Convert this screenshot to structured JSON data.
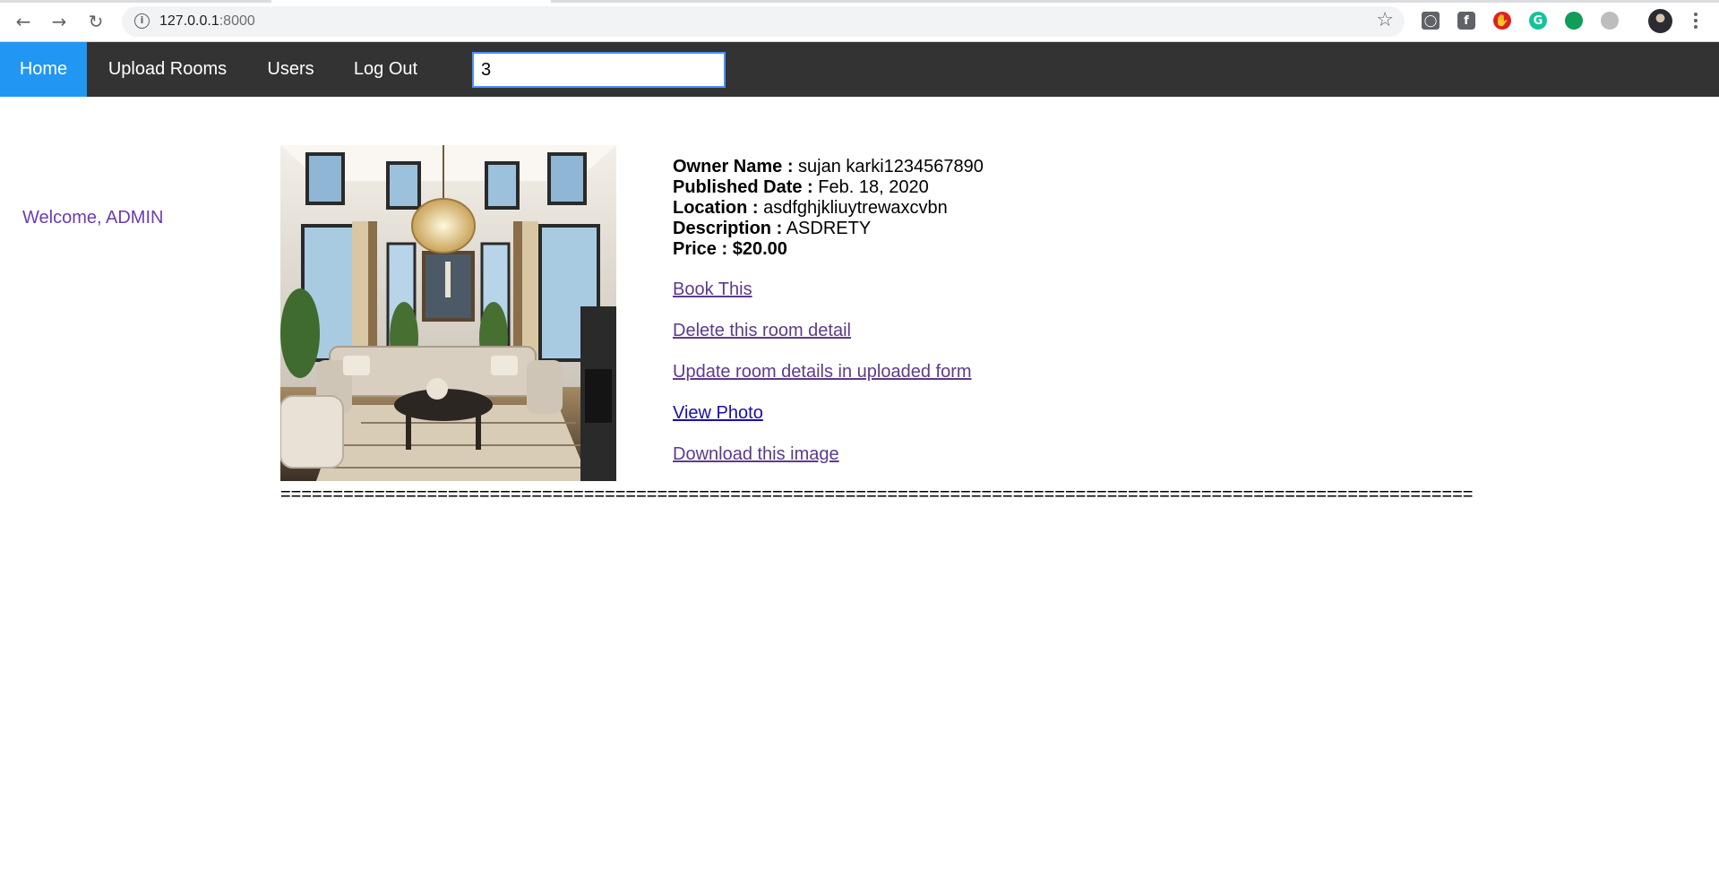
{
  "browser": {
    "url_host": "127.0.0.1",
    "url_port": ":8000"
  },
  "nav": {
    "items": [
      {
        "label": "Home",
        "active": true
      },
      {
        "label": "Upload Rooms",
        "active": false
      },
      {
        "label": "Users",
        "active": false
      },
      {
        "label": "Log Out",
        "active": false
      }
    ],
    "search_value": "3"
  },
  "colors": {
    "nav_bg": "#333333",
    "nav_active": "#2196F3",
    "link_visited": "#5c3a8c",
    "link_blue": "#1a0dab"
  },
  "welcome": "Welcome, ADMIN",
  "room": {
    "owner_label": "Owner Name :",
    "owner_value": "sujan karki1234567890",
    "date_label": "Published Date :",
    "date_value": "Feb. 18, 2020",
    "location_label": "Location :",
    "location_value": "asdfghjkliuytrewaxcvbn",
    "description_label": "Description :",
    "description_value": "ASDRETY",
    "price_label": "Price :",
    "price_value": "$20.00",
    "links": {
      "book": "Book This",
      "delete": "Delete this room detail",
      "update": "Update room details in uploaded form",
      "view_photo": "View Photo",
      "download": "Download this image"
    },
    "photo_alt": "living-room-photo"
  },
  "separator": "=================================================================================================================="
}
